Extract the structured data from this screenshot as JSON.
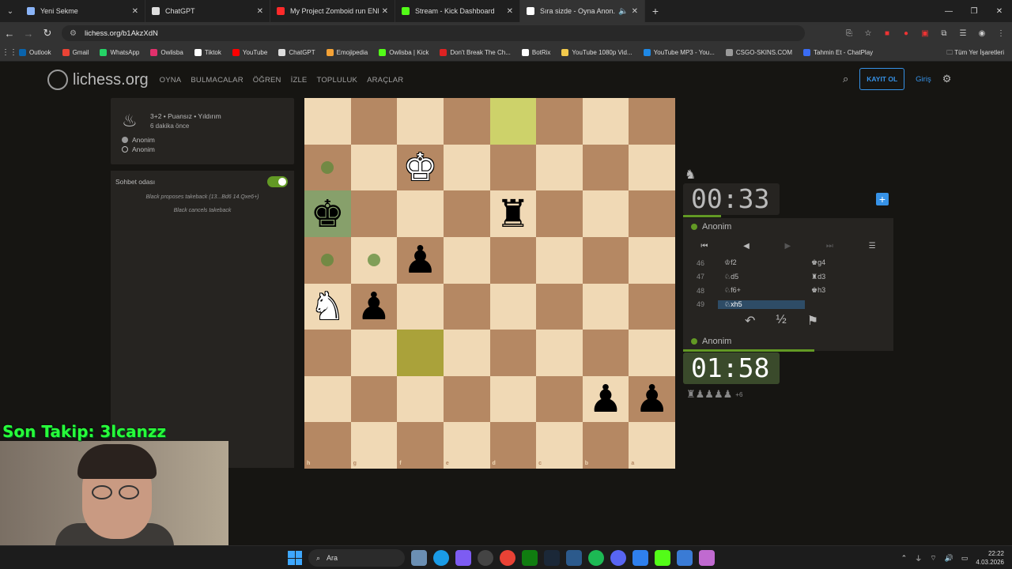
{
  "browser": {
    "tabs": [
      {
        "title": "Yeni Sekme",
        "color": "#8ab4f8"
      },
      {
        "title": "ChatGPT",
        "color": "#dddddd"
      },
      {
        "title": "My Project Zomboid run ENDE",
        "color": "#ff2a2a"
      },
      {
        "title": "Stream - Kick Dashboard",
        "color": "#53fc18"
      },
      {
        "title": "Sıra sizde - Oyna Anon. • li",
        "color": "#ffffff"
      }
    ],
    "url": "lichess.org/b1AkzXdN",
    "bookmarks": [
      {
        "label": "Outlook",
        "color": "#0a64ad"
      },
      {
        "label": "Gmail",
        "color": "#ea4335"
      },
      {
        "label": "WhatsApp",
        "color": "#25d366"
      },
      {
        "label": "Owlisba",
        "color": "#e1306c"
      },
      {
        "label": "Tiktok",
        "color": "#ffffff"
      },
      {
        "label": "YouTube",
        "color": "#ff0000"
      },
      {
        "label": "ChatGPT",
        "color": "#dddddd"
      },
      {
        "label": "Emojipedia",
        "color": "#f4a236"
      },
      {
        "label": "Owlisba | Kick",
        "color": "#53fc18"
      },
      {
        "label": "Don't Break The Ch...",
        "color": "#d22"
      },
      {
        "label": "BotRix",
        "color": "#ffffff"
      },
      {
        "label": "YouTube 1080p Vid...",
        "color": "#f2c94c"
      },
      {
        "label": "YouTube MP3 - You...",
        "color": "#1e88e5"
      },
      {
        "label": "CSGO-SKINS.COM",
        "color": "#999999"
      },
      {
        "label": "Tahmin Et - ChatPlay",
        "color": "#3a6cf4"
      }
    ],
    "all_bookmarks": "Tüm Yer İşaretleri"
  },
  "site": {
    "logo": "lichess.org",
    "nav": [
      "OYNA",
      "BULMACALAR",
      "ÖĞREN",
      "İZLE",
      "TOPLULUK",
      "ARAÇLAR"
    ],
    "signup": "KAYIT OL",
    "login": "Giriş"
  },
  "game_info": {
    "mode": "3+2 • Puansız • Yıldırım",
    "ago": "6 dakika önce",
    "players": [
      "Anonim",
      "Anonim"
    ]
  },
  "chat": {
    "title": "Sohbet odası",
    "messages": [
      "Black proposes takeback (13...Bd6 14.Qxe6+)",
      "Black cancels takeback"
    ]
  },
  "board": {
    "ranks": [
      "1",
      "2",
      "3",
      "4",
      "5",
      "6",
      "7",
      "8"
    ],
    "files": [
      "h",
      "g",
      "f",
      "e",
      "d",
      "c",
      "b",
      "a"
    ]
  },
  "clocks": {
    "top": "00:33",
    "top_player": "Anonim",
    "bottom": "01:58",
    "bottom_player": "Anonim"
  },
  "moves": [
    {
      "n": "46",
      "w": "♔f2",
      "b": "♚g4"
    },
    {
      "n": "47",
      "w": "♘d5",
      "b": "♜d3"
    },
    {
      "n": "48",
      "w": "♘f6+",
      "b": "♚h3"
    },
    {
      "n": "49",
      "w": "♘xh5",
      "b": ""
    }
  ],
  "material": {
    "pieces": "♜♟♟♟♟",
    "adv": "+6"
  },
  "stream": {
    "overlay": "Son Takip: 3lcanzz"
  },
  "taskbar": {
    "search": "Ara",
    "time": "22:22",
    "date": "4.03.2026"
  }
}
